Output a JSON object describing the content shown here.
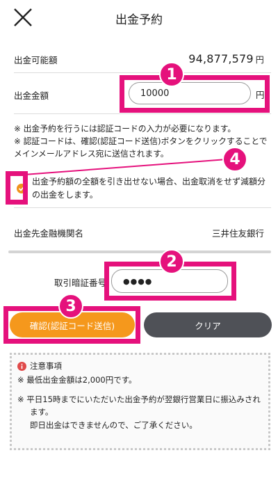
{
  "header": {
    "title": "出金予約"
  },
  "available": {
    "label": "出金可能額",
    "value": "94,877,579",
    "unit": "円"
  },
  "amount": {
    "label": "出金金額",
    "value": "10000",
    "unit": "円"
  },
  "notes": [
    "※ 出金予約を行うには認証コードの入力が必要になります。",
    "※ 認証コードは、確認(認証コード送信)ボタンをクリックすることでメインメールアドレス宛に送信されます。"
  ],
  "checkbox": {
    "label": "出金予約額の全額を引き出せない場合、出金取消をせず減額分の出金をします。",
    "checked": true
  },
  "bank": {
    "label": "出金先金融機関名",
    "value": "三井住友銀行"
  },
  "pin": {
    "label": "取引暗証番号",
    "value": "●●●●"
  },
  "buttons": {
    "confirm": "確認(認証コード送信)",
    "clear": "クリア"
  },
  "caution": {
    "title": "注意事項",
    "lines": [
      "※ 最低出金金額は2,000円です。",
      "※ 平日15時までにいただいた出金予約が翌銀行営業日に振込みされます。",
      "即日出金はできませんので、ご了承ください。"
    ]
  },
  "badges": [
    "1",
    "2",
    "3",
    "4"
  ],
  "colors": {
    "accent": "#f5981c",
    "highlight": "#e5117c",
    "clear": "#4f5157"
  },
  "icons": {
    "close": "close-icon",
    "check": "check-icon",
    "info": "info-icon"
  }
}
